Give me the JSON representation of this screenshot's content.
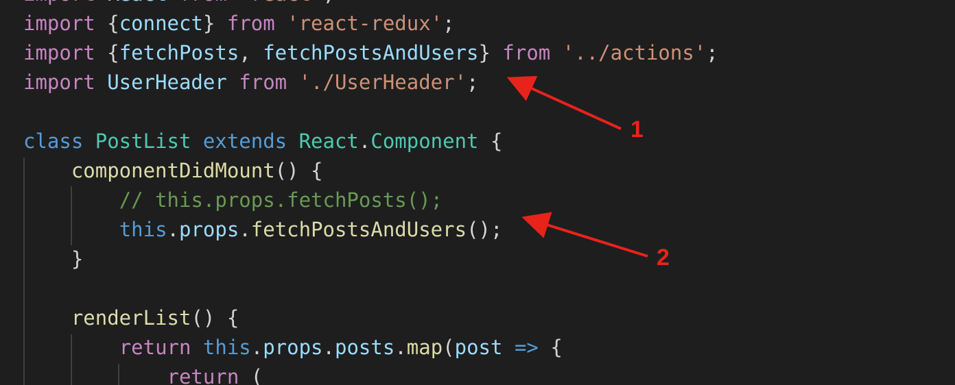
{
  "editor": {
    "lines": [
      [
        {
          "t": "import ",
          "c": "kw"
        },
        {
          "t": "React",
          "c": "var"
        },
        {
          "t": " from ",
          "c": "kw"
        },
        {
          "t": "'react'",
          "c": "str"
        },
        {
          "t": ";",
          "c": "punct"
        }
      ],
      [
        {
          "t": "import ",
          "c": "kw"
        },
        {
          "t": "{",
          "c": "punct"
        },
        {
          "t": "connect",
          "c": "var"
        },
        {
          "t": "} ",
          "c": "punct"
        },
        {
          "t": "from ",
          "c": "kw"
        },
        {
          "t": "'react-redux'",
          "c": "str"
        },
        {
          "t": ";",
          "c": "punct"
        }
      ],
      [
        {
          "t": "import ",
          "c": "kw"
        },
        {
          "t": "{",
          "c": "punct"
        },
        {
          "t": "fetchPosts",
          "c": "var"
        },
        {
          "t": ", ",
          "c": "punct"
        },
        {
          "t": "fetchPostsAndUsers",
          "c": "var"
        },
        {
          "t": "} ",
          "c": "punct"
        },
        {
          "t": "from ",
          "c": "kw"
        },
        {
          "t": "'../actions'",
          "c": "str"
        },
        {
          "t": ";",
          "c": "punct"
        }
      ],
      [
        {
          "t": "import ",
          "c": "kw"
        },
        {
          "t": "UserHeader",
          "c": "var"
        },
        {
          "t": " from ",
          "c": "kw"
        },
        {
          "t": "'./UserHeader'",
          "c": "str"
        },
        {
          "t": ";",
          "c": "punct"
        }
      ],
      [],
      [
        {
          "t": "class ",
          "c": "blue"
        },
        {
          "t": "PostList",
          "c": "type"
        },
        {
          "t": " extends ",
          "c": "blue"
        },
        {
          "t": "React",
          "c": "type"
        },
        {
          "t": ".",
          "c": "punct"
        },
        {
          "t": "Component",
          "c": "type"
        },
        {
          "t": " {",
          "c": "punct"
        }
      ],
      [
        {
          "t": "    ",
          "c": "punct"
        },
        {
          "t": "componentDidMount",
          "c": "fn"
        },
        {
          "t": "() {",
          "c": "punct"
        }
      ],
      [
        {
          "t": "        ",
          "c": "punct"
        },
        {
          "t": "// this.props.fetchPosts();",
          "c": "cmt"
        }
      ],
      [
        {
          "t": "        ",
          "c": "punct"
        },
        {
          "t": "this",
          "c": "blue"
        },
        {
          "t": ".",
          "c": "punct"
        },
        {
          "t": "props",
          "c": "var"
        },
        {
          "t": ".",
          "c": "punct"
        },
        {
          "t": "fetchPostsAndUsers",
          "c": "fn"
        },
        {
          "t": "();",
          "c": "punct"
        }
      ],
      [
        {
          "t": "    }",
          "c": "punct"
        }
      ],
      [],
      [
        {
          "t": "    ",
          "c": "punct"
        },
        {
          "t": "renderList",
          "c": "fn"
        },
        {
          "t": "() {",
          "c": "punct"
        }
      ],
      [
        {
          "t": "        ",
          "c": "punct"
        },
        {
          "t": "return ",
          "c": "kw"
        },
        {
          "t": "this",
          "c": "blue"
        },
        {
          "t": ".",
          "c": "punct"
        },
        {
          "t": "props",
          "c": "var"
        },
        {
          "t": ".",
          "c": "punct"
        },
        {
          "t": "posts",
          "c": "var"
        },
        {
          "t": ".",
          "c": "punct"
        },
        {
          "t": "map",
          "c": "fn"
        },
        {
          "t": "(",
          "c": "punct"
        },
        {
          "t": "post",
          "c": "var"
        },
        {
          "t": " => ",
          "c": "blue"
        },
        {
          "t": "{",
          "c": "punct"
        }
      ],
      [
        {
          "t": "            ",
          "c": "punct"
        },
        {
          "t": "return ",
          "c": "kw"
        },
        {
          "t": "(",
          "c": "punct"
        }
      ]
    ]
  },
  "annotations": {
    "callout_1": {
      "label": "1"
    },
    "callout_2": {
      "label": "2"
    }
  },
  "colors": {
    "background": "#1e1e1e",
    "annotation_red": "#e8231c"
  }
}
